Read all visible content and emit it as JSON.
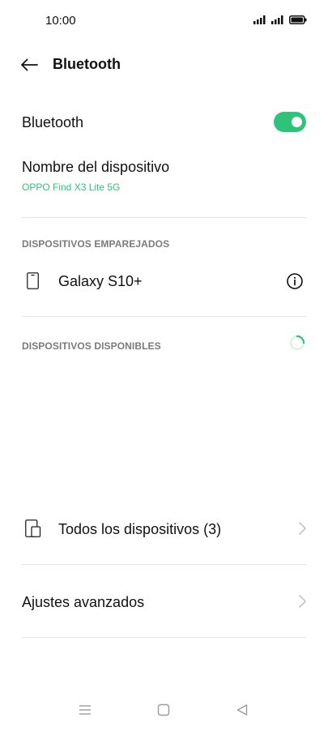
{
  "status_bar": {
    "time": "10:00"
  },
  "header": {
    "title": "Bluetooth"
  },
  "bluetooth_toggle": {
    "label": "Bluetooth",
    "state": "on",
    "accent_color": "#2fc27a"
  },
  "device_name": {
    "label": "Nombre del dispositivo",
    "value": "OPPO Find X3 Lite 5G"
  },
  "paired_section": {
    "header": "DISPOSITIVOS EMPAREJADOS",
    "devices": [
      {
        "name": "Galaxy S10+",
        "icon": "phone-icon",
        "action_icon": "info-icon"
      }
    ]
  },
  "available_section": {
    "header": "DISPOSITIVOS DISPONIBLES",
    "scanning": true
  },
  "all_devices": {
    "label": "Todos los dispositivos (3)",
    "icon": "devices-icon"
  },
  "advanced": {
    "label": "Ajustes avanzados"
  },
  "nav_bar": {
    "items": [
      "menu-icon",
      "home-icon",
      "back-icon"
    ]
  }
}
